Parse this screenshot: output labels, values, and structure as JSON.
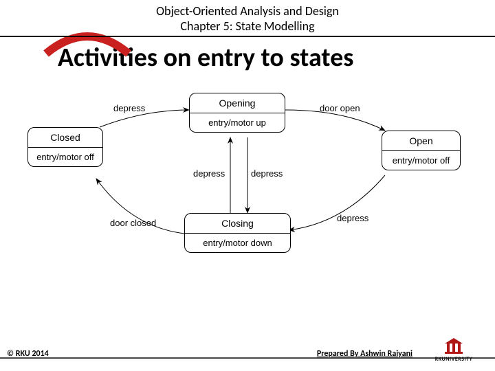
{
  "header": {
    "course_title_line1": "Object-Oriented Analysis and Design",
    "course_title_line2": "Chapter 5: State Modelling"
  },
  "main_title": "Activities on entry to states",
  "states": {
    "closed": {
      "name": "Closed",
      "entry": "entry/motor off"
    },
    "opening": {
      "name": "Opening",
      "entry": "entry/motor up"
    },
    "closing": {
      "name": "Closing",
      "entry": "entry/motor down"
    },
    "open": {
      "name": "Open",
      "entry": "entry/motor off"
    }
  },
  "transitions": {
    "closed_to_opening": "depress",
    "opening_to_open": "door open",
    "open_to_closing": "depress",
    "closing_to_closed": "door closed",
    "opening_to_closing": "depress",
    "closing_to_opening": "depress"
  },
  "footer": {
    "copyright": "© RKU 2014",
    "prepared": "Prepared By Ashwin Raiyani",
    "university": "RKUNIVERSITY"
  },
  "chart_data": {
    "type": "state-diagram",
    "title": "Activities on entry to states",
    "states": [
      {
        "id": "Closed",
        "entry_action": "motor off"
      },
      {
        "id": "Opening",
        "entry_action": "motor up"
      },
      {
        "id": "Closing",
        "entry_action": "motor down"
      },
      {
        "id": "Open",
        "entry_action": "motor off"
      }
    ],
    "transitions": [
      {
        "from": "Closed",
        "to": "Opening",
        "trigger": "depress"
      },
      {
        "from": "Opening",
        "to": "Open",
        "trigger": "door open"
      },
      {
        "from": "Open",
        "to": "Closing",
        "trigger": "depress"
      },
      {
        "from": "Closing",
        "to": "Closed",
        "trigger": "door closed"
      },
      {
        "from": "Opening",
        "to": "Closing",
        "trigger": "depress"
      },
      {
        "from": "Closing",
        "to": "Opening",
        "trigger": "depress"
      }
    ]
  }
}
